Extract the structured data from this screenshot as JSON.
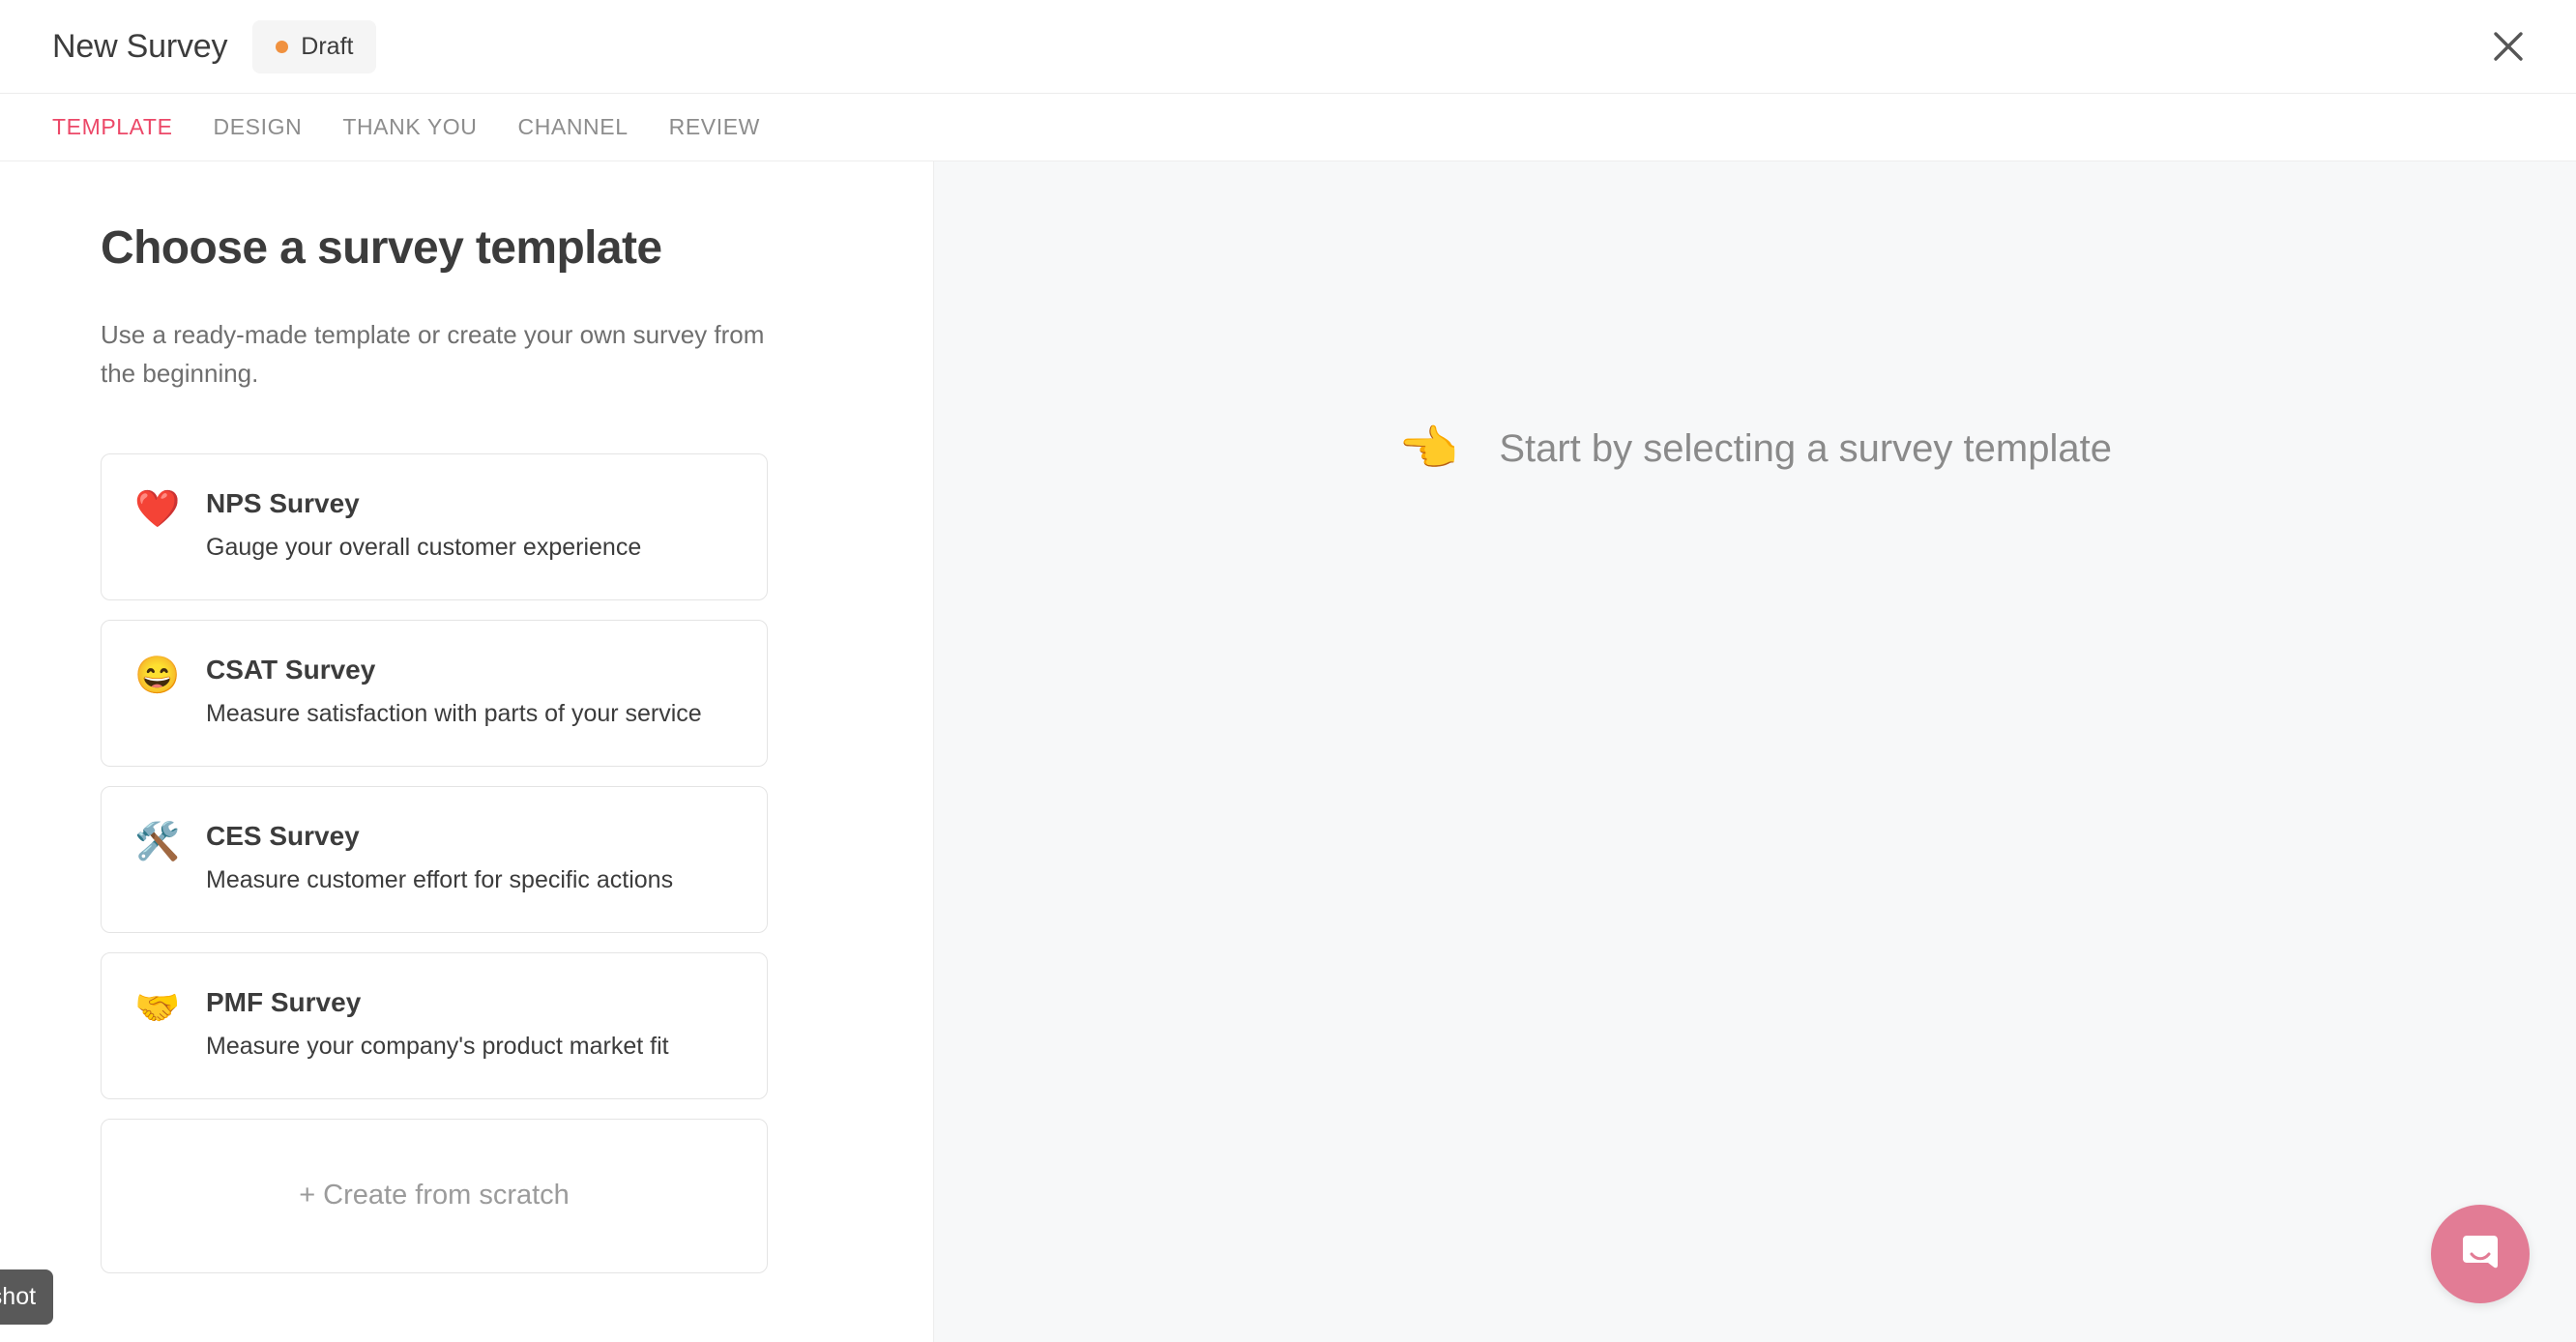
{
  "header": {
    "title": "New Survey",
    "status_label": "Draft",
    "status_dot_color": "#f0913f",
    "close_icon": "close-icon"
  },
  "tabs": [
    {
      "label": "TEMPLATE",
      "active": true
    },
    {
      "label": "DESIGN",
      "active": false
    },
    {
      "label": "THANK YOU",
      "active": false
    },
    {
      "label": "CHANNEL",
      "active": false
    },
    {
      "label": "REVIEW",
      "active": false
    }
  ],
  "tabs_active_color": "#ec4868",
  "left_pane": {
    "title": "Choose a survey template",
    "subtitle": "Use a ready-made template or create your own survey from the beginning.",
    "templates": [
      {
        "emoji": "❤️",
        "icon_name": "heart-icon",
        "title": "NPS Survey",
        "description": "Gauge your overall customer experience"
      },
      {
        "emoji": "😄",
        "icon_name": "grinning-face-icon",
        "title": "CSAT Survey",
        "description": "Measure satisfaction with parts of your service"
      },
      {
        "emoji": "🛠️",
        "icon_name": "hammer-and-wrench-icon",
        "title": "CES Survey",
        "description": "Measure customer effort for specific actions"
      },
      {
        "emoji": "🤝",
        "icon_name": "handshake-icon",
        "title": "PMF Survey",
        "description": "Measure your company's product market fit"
      }
    ],
    "create_from_scratch_label": "+ Create from scratch"
  },
  "right_pane": {
    "empty_emoji": "👈",
    "empty_icon_name": "pointing-left-hand-icon",
    "empty_text": "Start by selecting a survey template"
  },
  "intercom": {
    "icon_name": "chat-bubble-smile-icon",
    "color": "#e27c95"
  },
  "tooltip": {
    "text": "enshot"
  }
}
